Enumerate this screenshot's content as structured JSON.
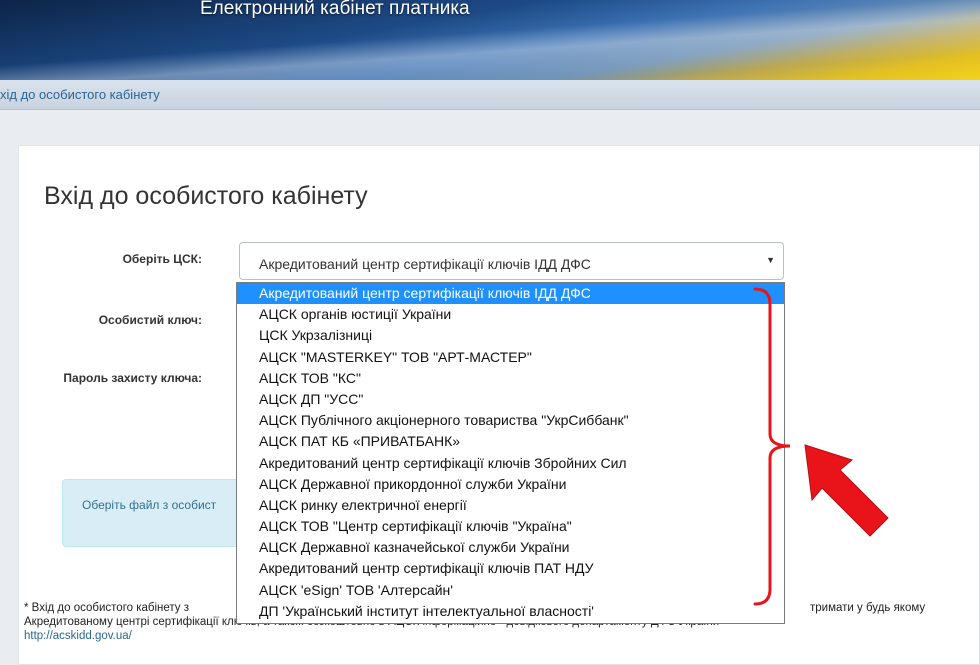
{
  "header": {
    "title": "Електронний кабінет платника"
  },
  "breadcrumb": {
    "text": "хід до особистого кабінету"
  },
  "page": {
    "title": "Вхід до особистого кабінету"
  },
  "form": {
    "csk_label": "Оберіть ЦСК:",
    "key_label": "Особистий ключ:",
    "password_label": "Пароль захисту ключа:",
    "csk_selected": "Акредитований центр сертифікації ключів ІДД ДФС",
    "csk_options": [
      "Акредитований центр сертифікації ключів ІДД ДФС",
      "АЦСК органів юстиції України",
      "ЦСК Укрзалізниці",
      "АЦСК \"MASTERKEY\" ТОВ \"АРТ-МАСТЕР\"",
      "АЦСК ТОВ \"КС\"",
      "АЦСК ДП \"УСС\"",
      "АЦСК Публічного акціонерного товариства \"УкрСиббанк\"",
      "АЦСК ПАТ КБ «ПРИВАТБАНК»",
      "Акредитований центр сертифікації ключів Збройних Сил",
      "АЦСК Державної прикордонної служби України",
      "АЦСК ринку електричної енергії",
      "АЦСК ТОВ \"Центр сертифікації ключів \"Україна\"",
      "АЦСК Державної казначейської служби України",
      "Акредитований центр сертифікації ключів ПАТ НДУ",
      "АЦСК 'eSign' ТОВ 'Алтерсайн'",
      "ДП 'Український інститут інтелектуальної власності'"
    ]
  },
  "info": {
    "text": "Оберіть файл з особист"
  },
  "footnote": {
    "line1": "* Вхід до особистого кабінету з",
    "line1_end": "тримати у будь якому",
    "line2": "Акредитованому центрі сертифікації ключів, а також безкоштовно в АЦСК інформаційно - довідкового департаменту ДФС України",
    "link": "http://acskidd.gov.ua/"
  },
  "colors": {
    "selected_option": "#1e90ff",
    "annotation": "#e8141a"
  }
}
